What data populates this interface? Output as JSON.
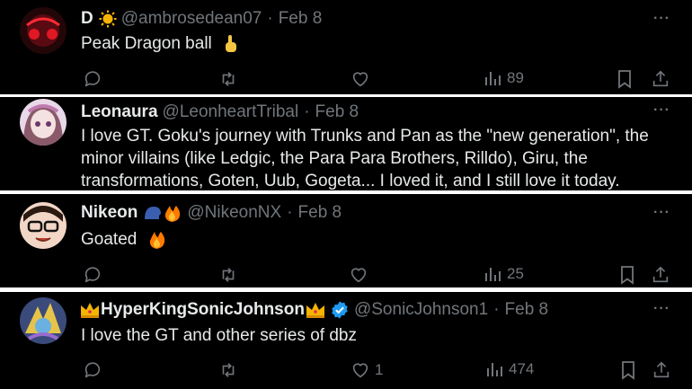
{
  "posts": [
    {
      "name": "D",
      "name_emoji": "sun-emoji",
      "handle": "@ambrosedean07",
      "separator": "·",
      "date": "Feb 8",
      "text": "Peak Dragon ball",
      "text_emoji": "pointing-up-emoji",
      "more": "···",
      "views": "89",
      "likes": ""
    },
    {
      "name": "Leonaura",
      "handle": "@LeonheartTribal",
      "separator": "·",
      "date": "Feb 8",
      "text": "I love GT. Goku's journey with Trunks and Pan as the \"new generation\", the minor villains (like Ledgic, the Para Para Brothers, Rilldo), Giru, the transformations, Goten, Uub, Gogeta... I loved it, and I still love it today.",
      "more": "···"
    },
    {
      "name": "Nikeon",
      "name_emoji": "speaking-head-and-fire-emoji",
      "handle": "@NikeonNX",
      "separator": "·",
      "date": "Feb 8",
      "text": "Goated",
      "text_emoji": "fire-emoji",
      "more": "···",
      "views": "25",
      "likes": ""
    },
    {
      "name": "HyperKingSonicJohnson",
      "name_emoji": "crown-emoji",
      "verified": true,
      "handle": "@SonicJohnson1",
      "separator": "·",
      "date": "Feb 8",
      "text": "I love the GT and other series of dbz",
      "more": "···",
      "views": "474",
      "likes": "1"
    }
  ],
  "colors": {
    "background": "#000000",
    "divider": "#ffffff",
    "text": "#e7e9ea",
    "muted": "#71767b",
    "verified": "#1d9bf0"
  }
}
